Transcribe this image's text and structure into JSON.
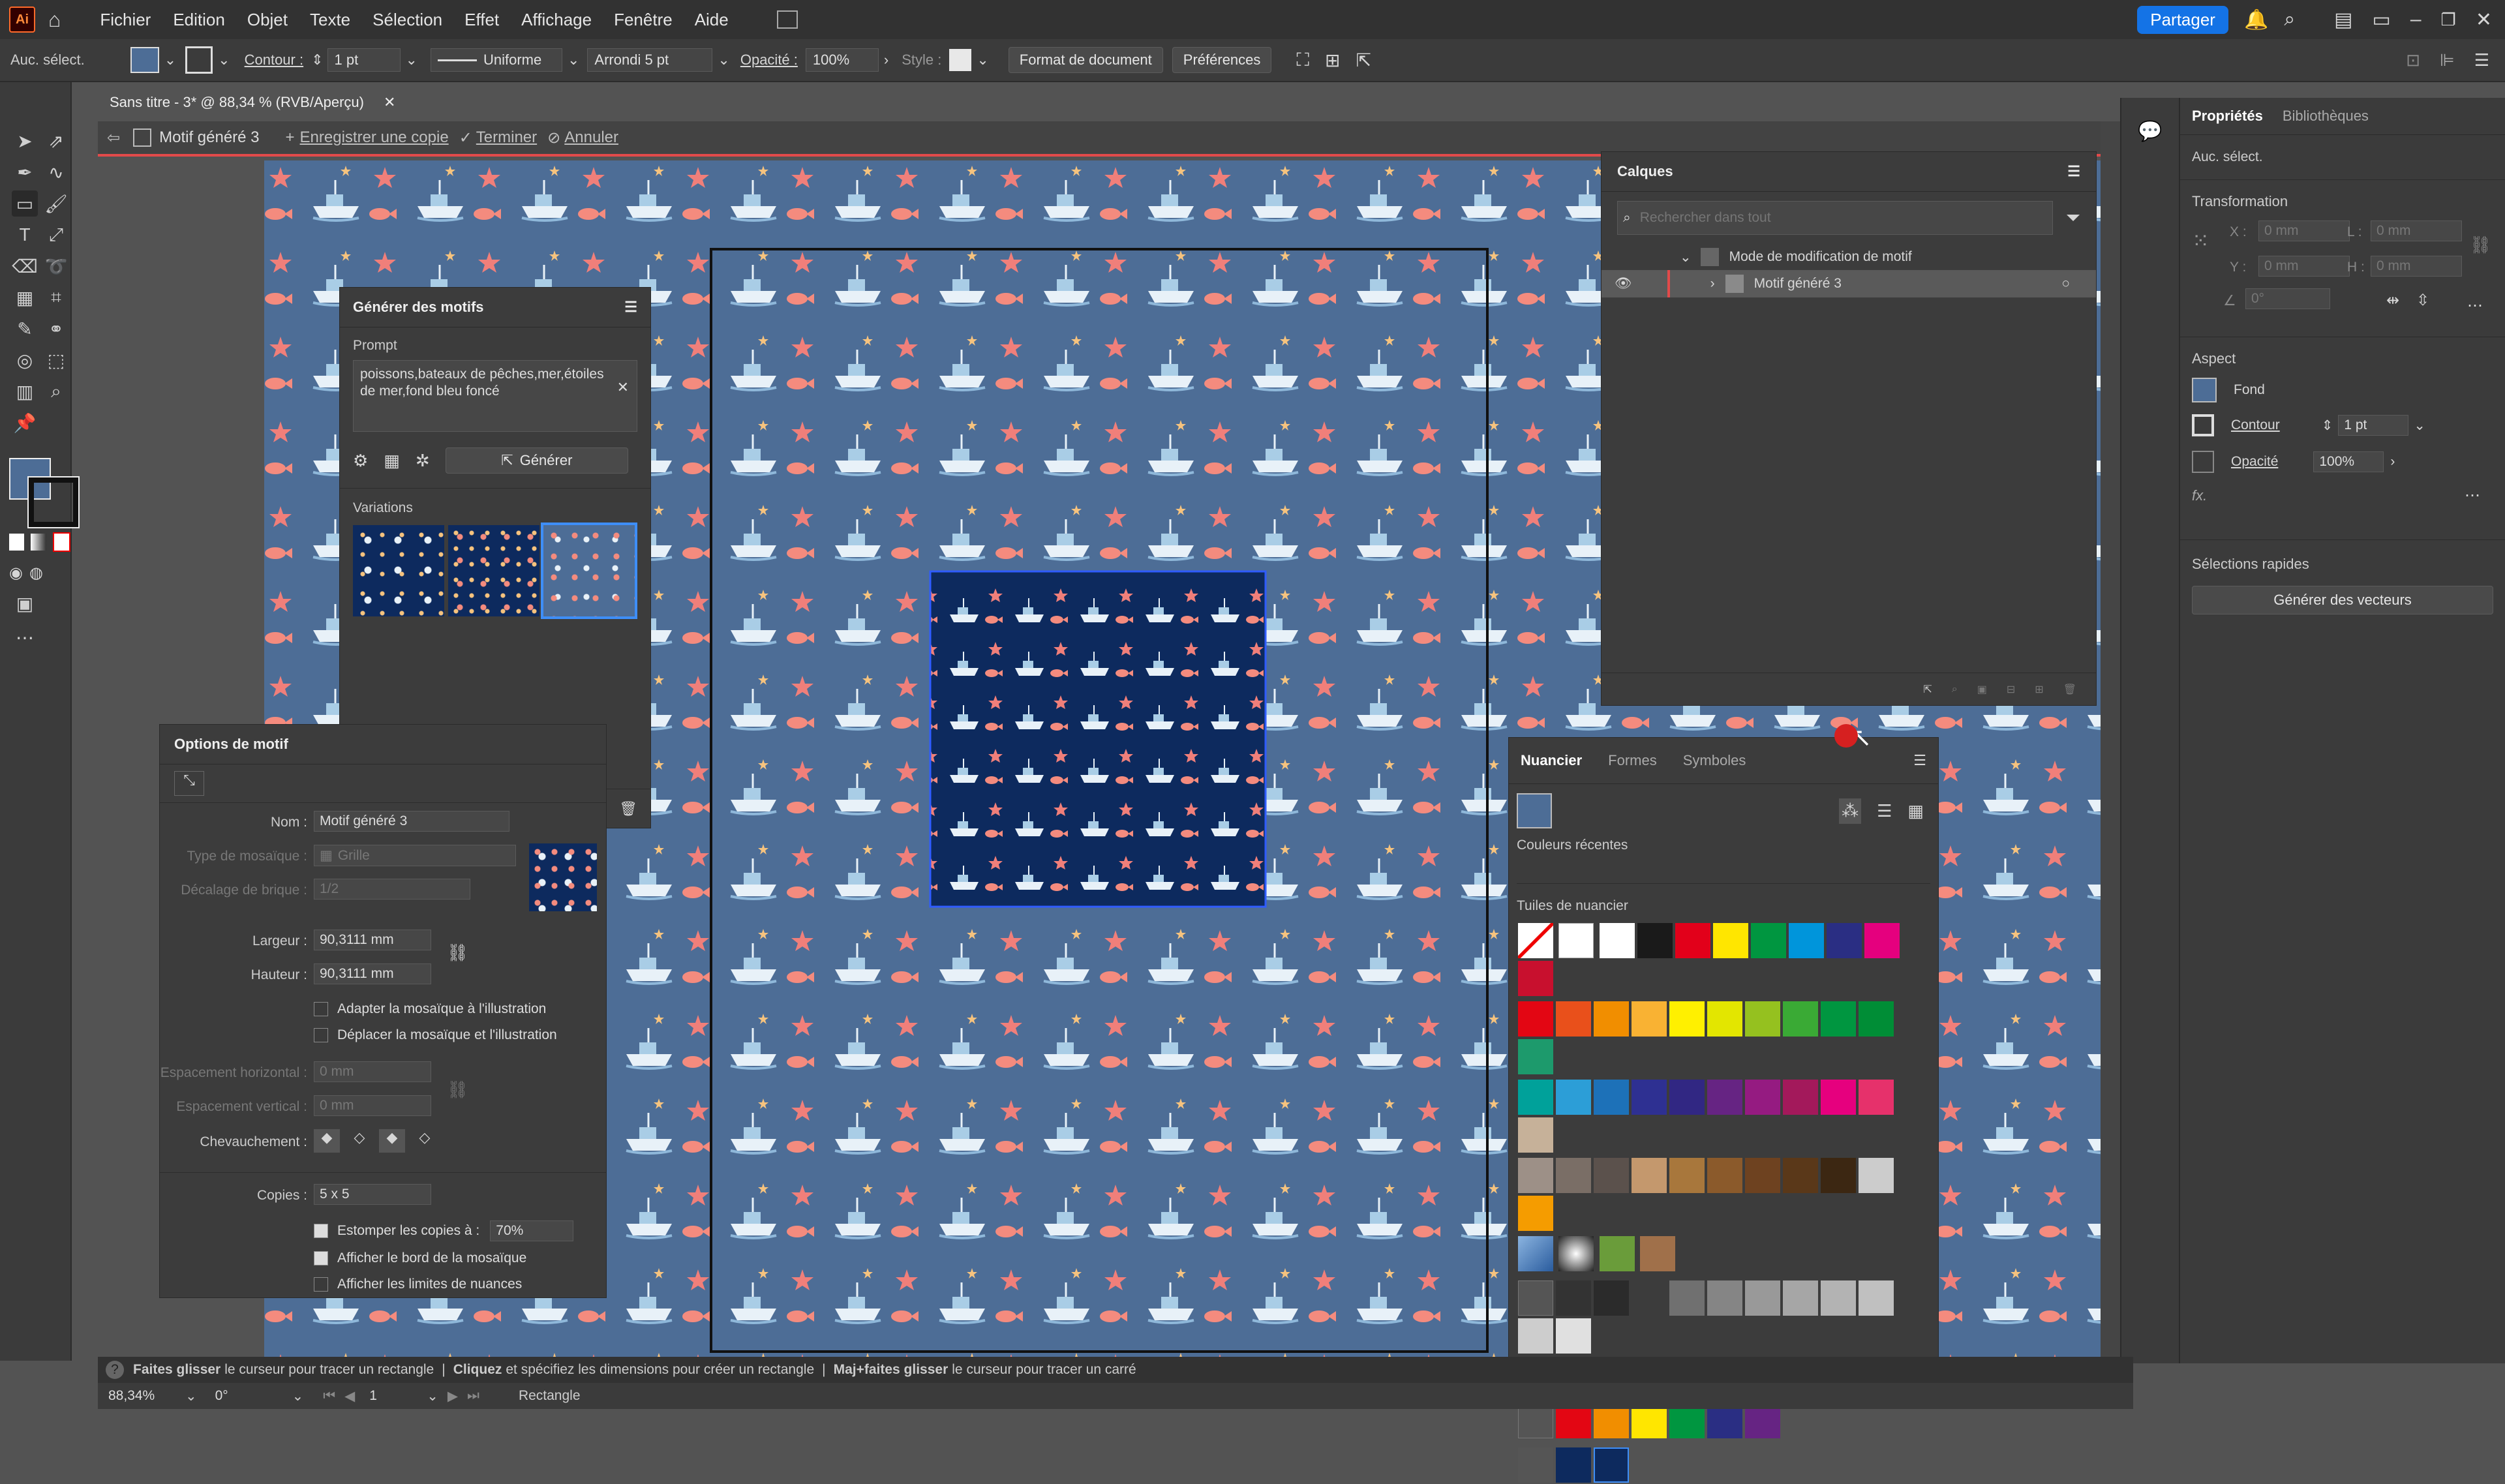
{
  "app": {
    "logo": "Ai",
    "menus": [
      "Fichier",
      "Edition",
      "Objet",
      "Texte",
      "Sélection",
      "Effet",
      "Affichage",
      "Fenêtre",
      "Aide"
    ],
    "share_label": "Partager"
  },
  "control_bar": {
    "selection": "Auc. sélect.",
    "stroke_label": "Contour :",
    "stroke_value": "1 pt",
    "stroke_profile": "Uniforme",
    "brush": "Arrondi 5 pt",
    "opacity_label": "Opacité :",
    "opacity_value": "100%",
    "style_label": "Style :",
    "doc_format_btn": "Format de document",
    "prefs_btn": "Préférences"
  },
  "document": {
    "tab_title": "Sans titre - 3* @ 88,34 % (RVB/Aperçu)",
    "pattern_name": "Motif généré 3",
    "save_copy": "Enregistrer une copie",
    "finish": "Terminer",
    "cancel": "Annuler"
  },
  "generator_panel": {
    "title": "Générer des motifs",
    "prompt_label": "Prompt",
    "prompt_text": "poissons,bateaux de pêches,mer,étoiles de mer,fond bleu foncé",
    "generate_btn": "Générer",
    "variations_label": "Variations"
  },
  "pattern_options": {
    "title": "Options de motif",
    "name_label": "Nom :",
    "name_value": "Motif généré 3",
    "tile_type_label": "Type de mosaïque :",
    "tile_type_value": "Grille",
    "brick_offset_label": "Décalage de brique :",
    "brick_offset_value": "1/2",
    "width_label": "Largeur :",
    "width_value": "90,3111 mm",
    "height_label": "Hauteur :",
    "height_value": "90,3111 mm",
    "fit_tile": "Adapter la mosaïque à l'illustration",
    "move_tile": "Déplacer la mosaïque et l'illustration",
    "h_spacing_label": "Espacement horizontal :",
    "h_spacing_value": "0 mm",
    "v_spacing_label": "Espacement vertical :",
    "v_spacing_value": "0 mm",
    "overlap_label": "Chevauchement :",
    "copies_label": "Copies :",
    "copies_value": "5 x 5",
    "dim_copies_label": "Estomper les copies à :",
    "dim_copies_value": "70%",
    "show_tile_edge": "Afficher le bord de la mosaïque",
    "show_swatch_bounds": "Afficher les limites de nuances"
  },
  "layers_panel": {
    "title": "Calques",
    "search_placeholder": "Rechercher dans tout",
    "layer1": "Mode de modification de motif",
    "layer2": "Motif généré 3"
  },
  "swatches_panel": {
    "tabs": [
      "Nuancier",
      "Formes",
      "Symboles"
    ],
    "recent_label": "Couleurs récentes",
    "tiles_label": "Tuiles de nuancier",
    "row1": [
      "#ffffff",
      "#ffffff",
      "#ffffff",
      "#1a1a1a",
      "#e2001a",
      "#ffe600",
      "#009640",
      "#0095db",
      "#2a2e83",
      "#e5007e",
      "#c8102e"
    ],
    "row2": [
      "#e30613",
      "#e9501b",
      "#f18e00",
      "#f9b233",
      "#fff000",
      "#e3e600",
      "#95c11f",
      "#3aaa35",
      "#009640",
      "#008d36",
      "#1d9a6c"
    ],
    "row3": [
      "#00a19a",
      "#2c9ed7",
      "#1d71b8",
      "#2e3092",
      "#312783",
      "#662483",
      "#951b81",
      "#a3195b",
      "#e6007e",
      "#e6316b",
      "#c6b199"
    ],
    "row4": [
      "#9d9087",
      "#7a6e66",
      "#5b514c",
      "#c4986d",
      "#a8773c",
      "#8b5a2b",
      "#6e4220",
      "#5a3819",
      "#3c2712",
      "#cccccc",
      "#f59c00"
    ],
    "row6": [
      "#333333",
      "#2b2b2b",
      "#3c3c3c",
      "#707070",
      "#858585",
      "#999999",
      "#a6a6a6",
      "#b3b3b3",
      "#c0c0c0",
      "#cdcdcd",
      "#e0e0e0"
    ],
    "row8": [
      "#e30613",
      "#f18e00",
      "#ffe600",
      "#009640",
      "#2a2e83",
      "#662483"
    ]
  },
  "properties_panel": {
    "tabs": [
      "Propriétés",
      "Bibliothèques"
    ],
    "selection": "Auc. sélect.",
    "transform_label": "Transformation",
    "x_label": "X :",
    "x_value": "0 mm",
    "y_label": "Y :",
    "y_value": "0 mm",
    "w_label": "L :",
    "w_value": "0 mm",
    "h_label": "H :",
    "h_value": "0 mm",
    "angle_value": "0°",
    "appearance_label": "Aspect",
    "fill_label": "Fond",
    "stroke_label": "Contour",
    "stroke_value": "1 pt",
    "opacity_label": "Opacité",
    "opacity_value": "100%",
    "fx_label": "fx.",
    "quick_label": "Sélections rapides",
    "vectors_btn": "Générer des vecteurs"
  },
  "status": {
    "hint_bold1": "Faites glisser",
    "hint1": "le curseur pour tracer un rectangle",
    "hint_bold2": "Cliquez",
    "hint2": "et spécifiez les dimensions pour créer un rectangle",
    "hint_bold3": "Maj+faites glisser",
    "hint3": "le curseur pour tracer un carré",
    "zoom": "88,34%",
    "rotation": "0°",
    "artboard": "1",
    "tool": "Rectangle"
  },
  "colors": {
    "pattern_bg": "#4d6d96",
    "tile_bg": "#0d2a5e",
    "accent": "#1473e6"
  }
}
